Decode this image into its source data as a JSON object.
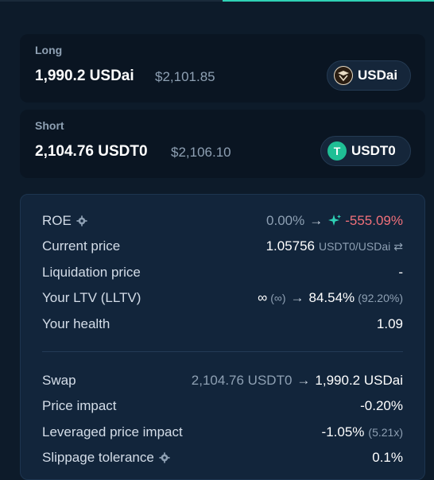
{
  "long": {
    "label": "Long",
    "amount": "1,990.2 USDai",
    "usd": "$2,101.85",
    "token": "USDai"
  },
  "short": {
    "label": "Short",
    "amount": "2,104.76 USDT0",
    "usd": "$2,106.10",
    "token": "USDT0",
    "token_glyph": "T"
  },
  "details": {
    "roe": {
      "label": "ROE",
      "from": "0.00%",
      "to": "-555.09%"
    },
    "current_price": {
      "label": "Current price",
      "value": "1.05756",
      "pair": "USDT0/USDai",
      "swap_glyph": "⇄"
    },
    "liquidation_price": {
      "label": "Liquidation price",
      "value": "-"
    },
    "ltv": {
      "label": "Your LTV (LLTV)",
      "from": "∞",
      "from_paren": "(∞)",
      "to": "84.54%",
      "to_paren": "(92.20%)"
    },
    "health": {
      "label": "Your health",
      "value": "1.09"
    },
    "swap": {
      "label": "Swap",
      "from": "2,104.76 USDT0",
      "to": "1,990.2 USDai"
    },
    "price_impact": {
      "label": "Price impact",
      "value": "-0.20%"
    },
    "leveraged_price_impact": {
      "label": "Leveraged price impact",
      "value": "-1.05%",
      "paren": "(5.21x)"
    },
    "slippage": {
      "label": "Slippage tolerance",
      "value": "0.1%"
    }
  },
  "arrow_glyph": "→",
  "colors": {
    "accent": "#2fd1b5",
    "negative": "#f0707a",
    "background": "#0d1b2a"
  },
  "icons": [
    "settings-gear-icon",
    "sparkle-icon",
    "usdai-token-icon",
    "usdt0-token-icon",
    "swap-arrows-icon"
  ]
}
